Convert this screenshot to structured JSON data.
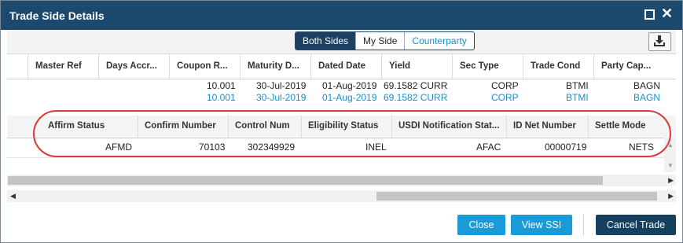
{
  "window": {
    "title": "Trade Side Details"
  },
  "toolbar": {
    "tabs": [
      "Both Sides",
      "My Side",
      "Counterparty"
    ],
    "active_tab": "Both Sides"
  },
  "grid1": {
    "headers": [
      "Master Ref",
      "Days Accr...",
      "Coupon R...",
      "Maturity D...",
      "Dated Date",
      "Yield",
      "Sec Type",
      "Trade Cond",
      "Party Cap..."
    ],
    "rows": [
      {
        "coupon": "10.001",
        "maturity": "30-Jul-2019",
        "dated": "01-Aug-2019",
        "yield": "69.1582 CURR",
        "sec_type": "CORP",
        "trade_cond": "BTMI",
        "party_cap": "BAGN"
      },
      {
        "coupon": "10.001",
        "maturity": "30-Jul-2019",
        "dated": "01-Aug-2019",
        "yield": "69.1582 CURR",
        "sec_type": "CORP",
        "trade_cond": "BTMI",
        "party_cap": "BAGN"
      }
    ]
  },
  "grid2": {
    "headers": [
      "Affirm Status",
      "Confirm Number",
      "Control Num",
      "Eligibility Status",
      "USDI Notification Stat...",
      "ID Net Number",
      "Settle Mode"
    ],
    "row": {
      "affirm_status": "AFMD",
      "confirm_number": "70103",
      "control_num": "302349929",
      "eligibility_status": "INEL",
      "usdi_notification": "AFAC",
      "id_net_number": "00000719",
      "settle_mode": "NETS"
    }
  },
  "footer": {
    "close_label": "Close",
    "view_ssi_label": "View SSI",
    "cancel_trade_label": "Cancel Trade"
  },
  "colors": {
    "titlebar": "#1c4a6e",
    "primary_button": "#1a9ad6",
    "dark_button": "#16405f",
    "link_blue": "#1a8fc8",
    "highlight": "#d63a3a"
  }
}
